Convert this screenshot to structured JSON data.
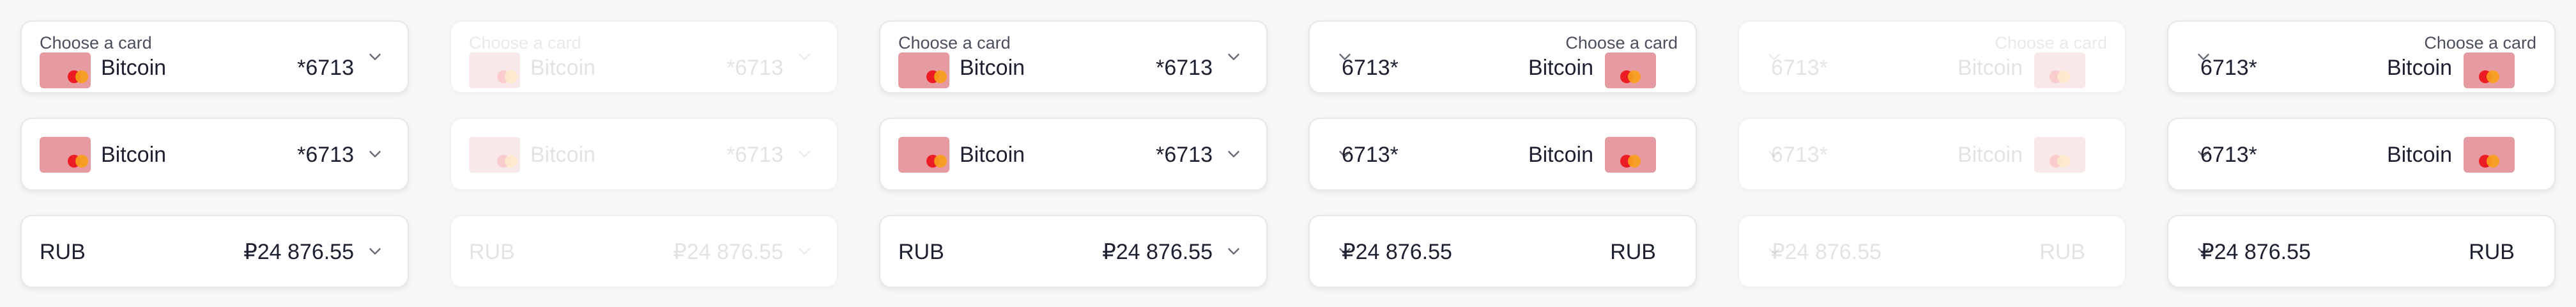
{
  "card_select": {
    "label": "Choose a card",
    "card_name": "Bitcoin",
    "masked_ltr": "*6713",
    "masked_rtl": "6713*",
    "card_icon": "mastercard-icon",
    "chevron_icon": "chevron-down-icon"
  },
  "currency_select": {
    "currency": "RUB",
    "amount": "₽24 876.55",
    "chevron_icon": "chevron-down-icon"
  },
  "colors": {
    "background": "#f7f7f8",
    "field_background": "#ffffff",
    "field_border": "#e6e7ea",
    "text": "#1d2030",
    "card_fill": "#e69aa1",
    "mastercard_red": "#eb1c24",
    "mastercard_yellow": "#f79e1b"
  },
  "variants": [
    "ltr-default",
    "ltr-disabled",
    "ltr-default",
    "rtl-default",
    "rtl-disabled",
    "rtl-default"
  ]
}
